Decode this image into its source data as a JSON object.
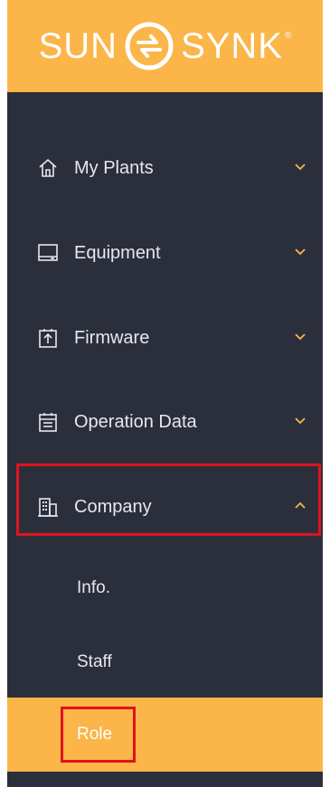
{
  "brand": {
    "logo_left": "SUN",
    "logo_right": "SYNK",
    "logo_mark": "®",
    "colors": {
      "accent": "#fbb549",
      "sidebar_bg": "#2b2f3b",
      "highlight": "#e0131f"
    }
  },
  "menu": [
    {
      "label": "My Plants",
      "icon": "home-icon",
      "state": "collapsed"
    },
    {
      "label": "Equipment",
      "icon": "monitor-icon",
      "state": "collapsed"
    },
    {
      "label": "Firmware",
      "icon": "upload-icon",
      "state": "collapsed"
    },
    {
      "label": "Operation Data",
      "icon": "calendar-icon",
      "state": "collapsed"
    },
    {
      "label": "Company",
      "icon": "building-icon",
      "state": "expanded"
    }
  ],
  "submenu": [
    {
      "label": "Info."
    },
    {
      "label": "Staff"
    },
    {
      "label": "Role",
      "active": true
    }
  ]
}
